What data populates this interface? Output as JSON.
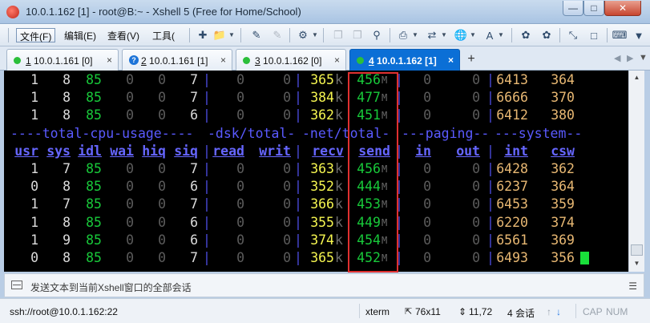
{
  "window": {
    "title": "10.0.1.162 [1] - root@B:~ - Xshell 5 (Free for Home/School)"
  },
  "menu": {
    "file": "文件(F)",
    "edit": "编辑(E)",
    "view": "查看(V)",
    "tools": "工具("
  },
  "tabs": [
    {
      "num": "1",
      "label": "10.0.1.161 [0]",
      "status": "connected"
    },
    {
      "num": "2",
      "label": "10.0.1.161 [1]",
      "status": "warning"
    },
    {
      "num": "3",
      "label": "10.0.1.162 [0]",
      "status": "connected"
    },
    {
      "num": "4",
      "label": "10.0.1.162 [1]",
      "status": "connected",
      "active": true
    }
  ],
  "terminal": {
    "section_headers": {
      "cpu": "----total-cpu-usage----",
      "dsk": "-dsk/total-",
      "net": "-net/total-",
      "paging": "---paging--",
      "system": "---system--"
    },
    "columns": [
      "usr",
      "sys",
      "idl",
      "wai",
      "hiq",
      "siq",
      "read",
      "writ",
      "recv",
      "send",
      "in",
      "out",
      "int",
      "csw"
    ],
    "rows_before": [
      {
        "usr": "1",
        "sys": "8",
        "idl": "85",
        "wai": "0",
        "hiq": "0",
        "siq": "7",
        "read": "0",
        "writ": "0",
        "recv": "365",
        "send": "456",
        "in": "0",
        "out": "0",
        "int": "6413",
        "csw": "364"
      },
      {
        "usr": "1",
        "sys": "8",
        "idl": "85",
        "wai": "0",
        "hiq": "0",
        "siq": "7",
        "read": "0",
        "writ": "0",
        "recv": "384",
        "send": "477",
        "in": "0",
        "out": "0",
        "int": "6666",
        "csw": "370"
      },
      {
        "usr": "1",
        "sys": "8",
        "idl": "85",
        "wai": "0",
        "hiq": "0",
        "siq": "6",
        "read": "0",
        "writ": "0",
        "recv": "362",
        "send": "451",
        "in": "0",
        "out": "0",
        "int": "6412",
        "csw": "380"
      }
    ],
    "rows_after": [
      {
        "usr": "1",
        "sys": "7",
        "idl": "85",
        "wai": "0",
        "hiq": "0",
        "siq": "7",
        "read": "0",
        "writ": "0",
        "recv": "363",
        "send": "456",
        "in": "0",
        "out": "0",
        "int": "6428",
        "csw": "362"
      },
      {
        "usr": "0",
        "sys": "8",
        "idl": "85",
        "wai": "0",
        "hiq": "0",
        "siq": "6",
        "read": "0",
        "writ": "0",
        "recv": "352",
        "send": "444",
        "in": "0",
        "out": "0",
        "int": "6237",
        "csw": "364"
      },
      {
        "usr": "1",
        "sys": "7",
        "idl": "85",
        "wai": "0",
        "hiq": "0",
        "siq": "7",
        "read": "0",
        "writ": "0",
        "recv": "366",
        "send": "453",
        "in": "0",
        "out": "0",
        "int": "6453",
        "csw": "359"
      },
      {
        "usr": "1",
        "sys": "8",
        "idl": "85",
        "wai": "0",
        "hiq": "0",
        "siq": "6",
        "read": "0",
        "writ": "0",
        "recv": "355",
        "send": "449",
        "in": "0",
        "out": "0",
        "int": "6220",
        "csw": "374"
      },
      {
        "usr": "1",
        "sys": "9",
        "idl": "85",
        "wai": "0",
        "hiq": "0",
        "siq": "6",
        "read": "0",
        "writ": "0",
        "recv": "374",
        "send": "454",
        "in": "0",
        "out": "0",
        "int": "6561",
        "csw": "369"
      },
      {
        "usr": "0",
        "sys": "8",
        "idl": "85",
        "wai": "0",
        "hiq": "0",
        "siq": "7",
        "read": "0",
        "writ": "0",
        "recv": "365",
        "send": "452",
        "in": "0",
        "out": "0",
        "int": "6493",
        "csw": "356"
      }
    ],
    "recv_unit": "k",
    "send_unit": "M"
  },
  "compose": {
    "placeholder": "发送文本到当前Xshell窗口的全部会话"
  },
  "status": {
    "connection": "ssh://root@10.0.1.162:22",
    "term": "xterm",
    "size": "76x11",
    "cursor": "11,72",
    "sessions": "4 会话",
    "caps": "CAP",
    "num": "NUM"
  }
}
